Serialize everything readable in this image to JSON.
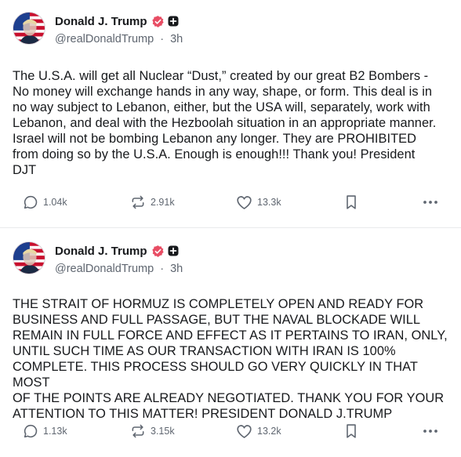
{
  "posts": [
    {
      "author": {
        "display_name": "Donald J. Trump",
        "handle": "@realDonaldTrump",
        "time": "3h"
      },
      "text": "The U.S.A. will get all Nuclear “Dust,” created by our great B2 Bombers -\nNo money will exchange hands in any way, shape, or form. This deal is in\nno way subject to Lebanon, either, but the USA will, separately, work with\nLebanon, and deal with the Hezboolah situation in an appropriate manner.\nIsrael will not be bombing Lebanon any longer. They are PROHIBITED\nfrom doing so by the U.S.A. Enough is enough!!! Thank you! President\nDJT",
      "stats": {
        "replies": "1.04k",
        "reposts": "2.91k",
        "likes": "13.3k"
      }
    },
    {
      "author": {
        "display_name": "Donald J. Trump",
        "handle": "@realDonaldTrump",
        "time": "3h"
      },
      "text": "THE STRAIT OF HORMUZ IS COMPLETELY OPEN AND READY FOR\nBUSINESS AND FULL PASSAGE, BUT THE NAVAL BLOCKADE WILL\nREMAIN IN FULL FORCE AND EFFECT AS IT PERTAINS TO IRAN, ONLY,\nUNTIL SUCH TIME AS OUR TRANSACTION WITH IRAN IS 100%\nCOMPLETE. THIS PROCESS SHOULD GO VERY QUICKLY IN THAT MOST\nOF THE POINTS ARE ALREADY NEGOTIATED. THANK YOU FOR YOUR\nATTENTION TO THIS MATTER! PRESIDENT DONALD J.TRUMP",
      "stats": {
        "replies": "1.13k",
        "reposts": "3.15k",
        "likes": "13.2k"
      }
    }
  ],
  "separator": "·",
  "colors": {
    "verified_badge": "#e84d64",
    "text": "#17191c",
    "muted": "#5f6670",
    "divider": "#e9eaec"
  },
  "icons": {
    "reply": "comment-bubble-icon",
    "repost": "repost-arrows-icon",
    "like": "heart-icon",
    "bookmark": "bookmark-icon",
    "more": "more-dots-icon",
    "verified": "verified-badge-icon",
    "plus": "plus-badge-icon"
  }
}
